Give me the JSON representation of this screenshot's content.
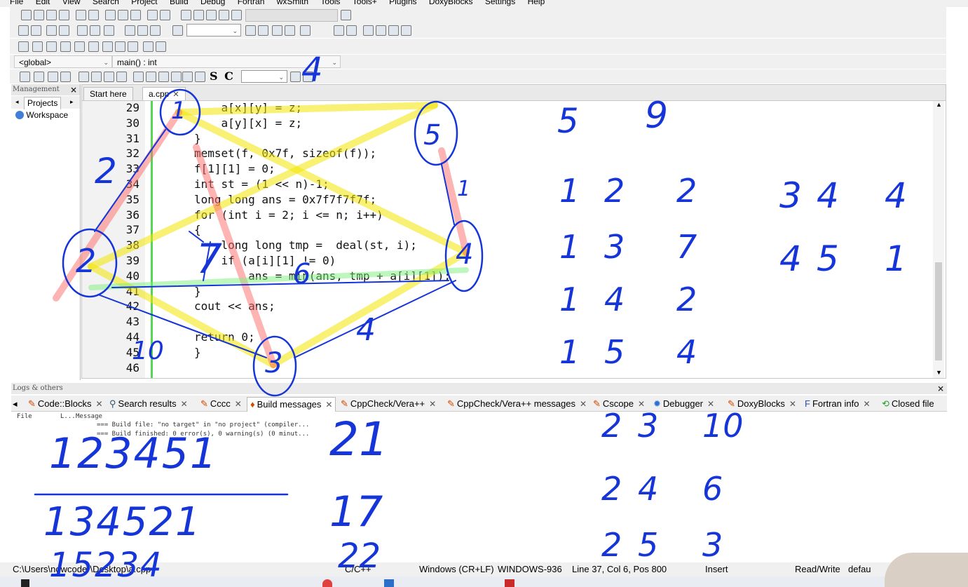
{
  "menu": [
    "File",
    "Edit",
    "View",
    "Search",
    "Project",
    "Build",
    "Debug",
    "Fortran",
    "wxSmith",
    "Tools",
    "Tools+",
    "Plugins",
    "DoxyBlocks",
    "Settings",
    "Help"
  ],
  "toolbar": {
    "scope_combo": "<global>",
    "function_combo": "main() : int",
    "sc_label": "S C"
  },
  "management": {
    "title": "Management",
    "projects_tab": "Projects",
    "workspace": "Workspace"
  },
  "editor": {
    "tabs": [
      {
        "label": "Start here",
        "active": false
      },
      {
        "label": "a.cpp",
        "active": true
      }
    ],
    "lines": [
      {
        "n": "29",
        "text": "    a[x][y] = z;"
      },
      {
        "n": "30",
        "text": "    a[y][x] = z;"
      },
      {
        "n": "31",
        "text": "}"
      },
      {
        "n": "32",
        "text": "memset(f, 0x7f, sizeof(f));"
      },
      {
        "n": "33",
        "text": "f[1][1] = 0;"
      },
      {
        "n": "34",
        "text": "int st = (1 << n)-1;"
      },
      {
        "n": "35",
        "text": "long long ans = 0x7f7f7f7f;"
      },
      {
        "n": "36",
        "text": "for (int i = 2; i <= n; i++)"
      },
      {
        "n": "37",
        "text": "{"
      },
      {
        "n": "38",
        "text": "    long long tmp =  deal(st, i);"
      },
      {
        "n": "39",
        "text": "    if (a[i][1] != 0)"
      },
      {
        "n": "40",
        "text": "        ans = min(ans, tmp + a[i][1]);"
      },
      {
        "n": "41",
        "text": "}"
      },
      {
        "n": "42",
        "text": "cout << ans;"
      },
      {
        "n": "43",
        "text": ""
      },
      {
        "n": "44",
        "text": "return 0;"
      },
      {
        "n": "45",
        "text": "}"
      },
      {
        "n": "46",
        "text": ""
      }
    ]
  },
  "logs": {
    "title": "Logs & others",
    "tabs": [
      "Code::Blocks",
      "Search results",
      "Cccc",
      "Build messages",
      "CppCheck/Vera++",
      "CppCheck/Vera++ messages",
      "Cscope",
      "Debugger",
      "DoxyBlocks",
      "Fortran info",
      "Closed file"
    ],
    "active_tab": "Build messages",
    "col_file": "File",
    "col_line": "L...",
    "col_message": "Message",
    "msg1": "=== Build file: \"no target\" in \"no project\" (compiler...",
    "msg2": "=== Build finished: 0 error(s), 0 warning(s) (0 minut..."
  },
  "status": {
    "path": "C:\\Users\\nowcoder\\Desktop\\a.cpp",
    "lang": "C/C++",
    "eol": "Windows (CR+LF)",
    "encoding": "WINDOWS-936",
    "position": "Line 37, Col 6, Pos 800",
    "mode": "Insert",
    "access": "Read/Write",
    "extra": "defau"
  },
  "handwriting": {
    "edge_list": [
      [
        "5",
        "9"
      ],
      [
        "1",
        "2",
        "2"
      ],
      [
        "1",
        "3",
        "7"
      ],
      [
        "1",
        "4",
        "2"
      ],
      [
        "1",
        "5",
        "4"
      ],
      [
        "2",
        "3",
        "10"
      ],
      [
        "2",
        "4",
        "6"
      ],
      [
        "2",
        "5",
        "3"
      ],
      [
        "3",
        "4",
        "4"
      ],
      [
        "4",
        "5",
        "1"
      ]
    ],
    "graph_nodes": [
      "1",
      "2",
      "3",
      "4",
      "5"
    ],
    "graph_edge_weights": [
      "2",
      "4",
      "1",
      "4",
      "7",
      "6",
      "10"
    ],
    "perm1": "123451",
    "perm2": "134521",
    "perm3": "15234",
    "sums": [
      "21",
      "17",
      "22"
    ]
  },
  "colors": {
    "ink": "#1535d8",
    "yellow": "#f2e600",
    "red": "#ff6a6a",
    "green": "#7ef07e"
  }
}
